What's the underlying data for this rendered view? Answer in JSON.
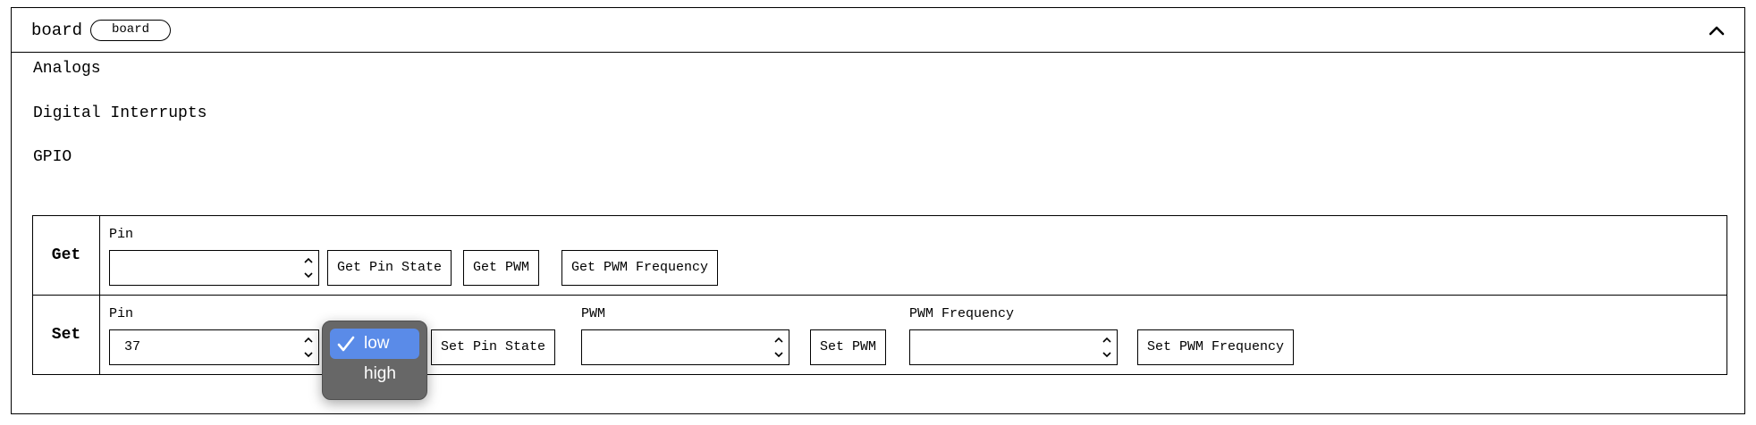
{
  "card": {
    "title": "board",
    "badge": "board",
    "collapse_icon": "chevron-up-icon"
  },
  "sections": {
    "analogs": "Analogs",
    "digital_interrupts": "Digital Interrupts",
    "gpio": "GPIO"
  },
  "gpio": {
    "get": {
      "row_label": "Get",
      "pin_label": "Pin",
      "pin_value": "",
      "buttons": {
        "get_pin_state": "Get Pin State",
        "get_pwm": "Get PWM",
        "get_pwm_frequency": "Get PWM Frequency"
      }
    },
    "set": {
      "row_label": "Set",
      "pin_label": "Pin",
      "pin_value": "37",
      "state_options": [
        "low",
        "high"
      ],
      "state_selected": "low",
      "set_pin_state": "Set Pin State",
      "pwm_label": "PWM",
      "pwm_value": "",
      "set_pwm": "Set PWM",
      "pwm_frequency_label": "PWM Frequency",
      "pwm_frequency_value": "",
      "set_pwm_frequency": "Set PWM Frequency"
    }
  },
  "colors": {
    "dropdown_bg": "#676767",
    "selected_option": "#5a8be8"
  }
}
